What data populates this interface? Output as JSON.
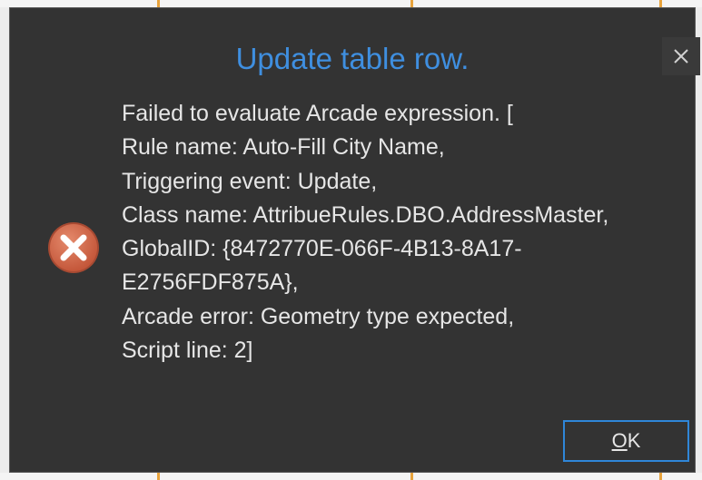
{
  "dialog": {
    "title": "Update table row.",
    "close_symbol": "✕",
    "message_lines": [
      "Failed to evaluate Arcade expression. [",
      "Rule name: Auto-Fill City Name,",
      "Triggering event: Update,",
      "Class name: AttribueRules.DBO.AddressMaster,",
      "GlobalID: {8472770E-066F-4B13-8A17-",
      "E2756FDF875A},",
      "Arcade error: Geometry type expected,",
      "Script line: 2]"
    ],
    "ok_button": {
      "mnemonic": "O",
      "rest": "K"
    },
    "icons": {
      "error": "error-circle-x-icon",
      "close": "close-icon"
    }
  },
  "colors": {
    "dialog_bg": "#333333",
    "title": "#3f8fe0",
    "text": "#e6e6e6",
    "button_border": "#2f86d8",
    "error_icon": "#d0674a"
  }
}
